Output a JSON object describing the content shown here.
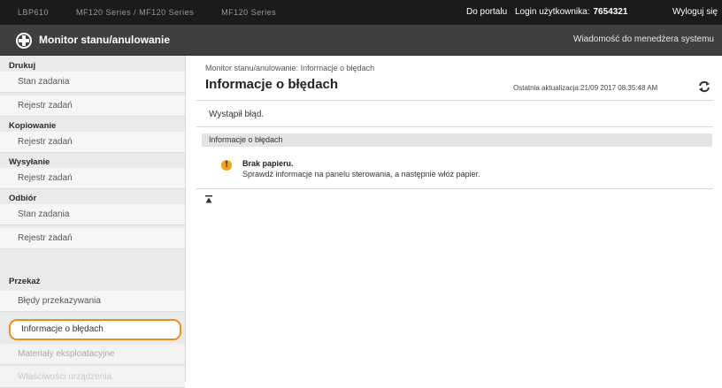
{
  "topbar": {
    "device_fields": [
      "LBP610",
      "MF120 Series / MF120 Series",
      "MF120 Series"
    ],
    "portal_link": "Do portalu",
    "login_label": "Login użytkownika:",
    "login_user": "7654321",
    "logout_link": "Wyloguj się"
  },
  "titlebar": {
    "app_title": "Monitor stanu/anulowanie",
    "admin_message_link": "Wiadomość do menedżera systemu"
  },
  "sidebar": {
    "sections": [
      {
        "heading": "Drukuj",
        "items": [
          "Stan zadania",
          "Rejestr zadań"
        ]
      },
      {
        "heading": "Kopiowanie",
        "items": [
          "Rejestr zadań"
        ]
      },
      {
        "heading": "Wysyłanie",
        "items": [
          "Rejestr zadań"
        ]
      },
      {
        "heading": "Odbiór",
        "items": [
          "Stan zadania",
          "Rejestr zadań"
        ]
      },
      {
        "heading": "Przekaż",
        "items": [
          "Błędy przekazywania",
          "Informacje o błędach",
          "Materiały eksploatacyjne",
          "Właściwości urządzenia"
        ]
      }
    ]
  },
  "main": {
    "breadcrumb": "Monitor stanu/anulowanie: Informacje o błędach",
    "title": "Informacje o błędach",
    "last_update": "Ostatnia aktualizacja:21/09 2017 08:35:48 AM",
    "status_text": "Wystąpił błąd.",
    "section_heading": "Informacje o błędach",
    "error": {
      "title": "Brak papieru.",
      "description": "Sprawdź informacje na panelu sterowania, a następnie włóż papier."
    }
  }
}
